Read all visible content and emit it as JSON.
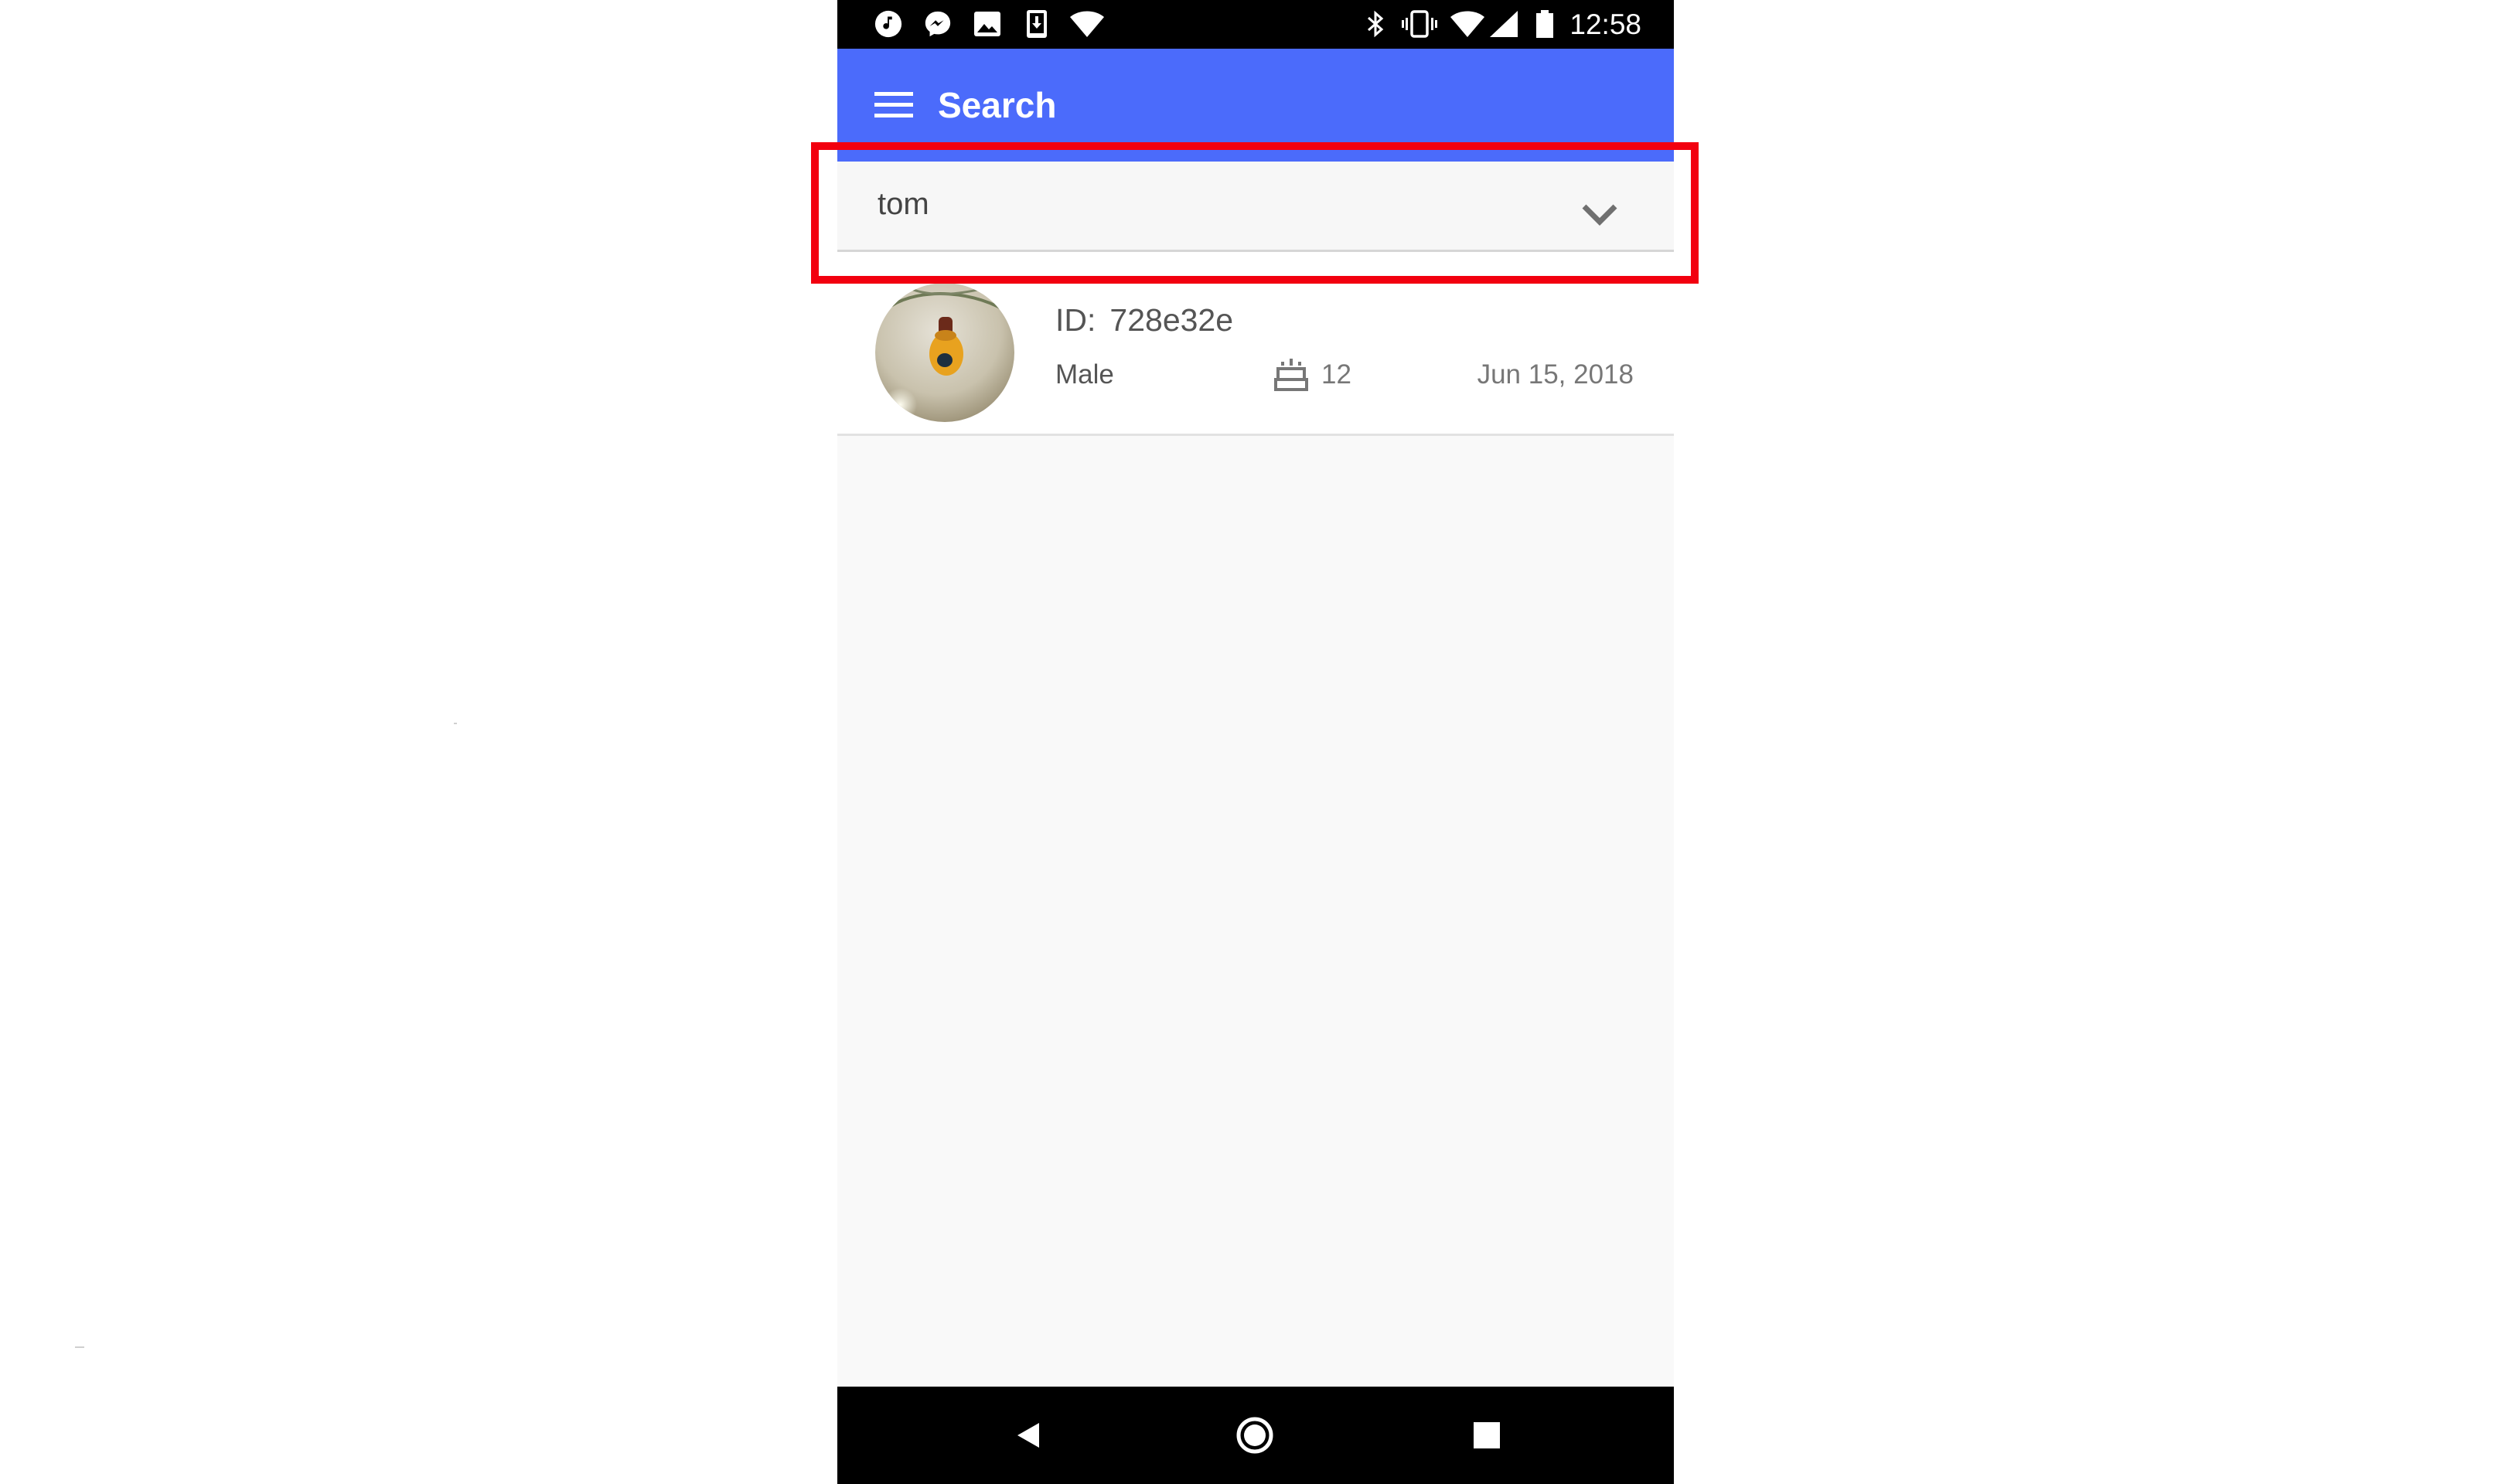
{
  "status_bar": {
    "time": "12:58",
    "left_icons": [
      "music-icon",
      "messenger-icon",
      "image-icon",
      "download-icon",
      "wifi-icon"
    ],
    "right_icons": [
      "bluetooth-icon",
      "vibrate-icon",
      "wifi-icon",
      "cellular-signal-icon",
      "battery-icon"
    ]
  },
  "app_bar": {
    "title": "Search",
    "menu_icon": "menu-icon",
    "color": "#4b6bfb"
  },
  "search_select": {
    "value": "tom",
    "icon": "chevron-down-icon"
  },
  "highlight_color": "#f2000f",
  "results": [
    {
      "id_label": "ID:",
      "id_value": "728e32e",
      "gender": "Male",
      "age_icon": "birthday-cake-icon",
      "age": "12",
      "date": "Jun 15, 2018"
    }
  ],
  "nav_bar": {
    "icons": [
      "back-icon",
      "home-icon",
      "recents-icon"
    ]
  }
}
